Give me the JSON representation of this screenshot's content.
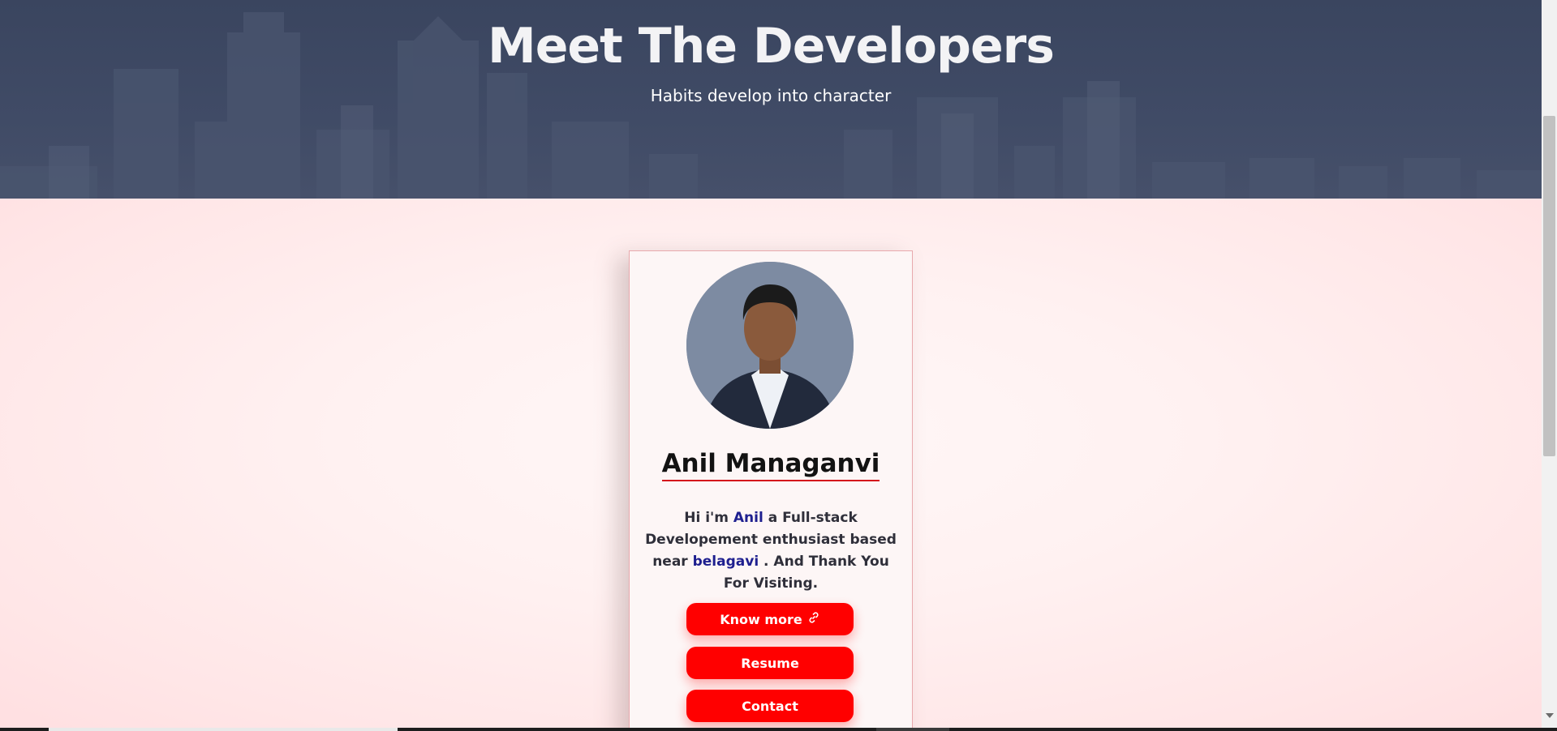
{
  "hero": {
    "title": "Meet The Developers",
    "subtitle": "Habits develop into character"
  },
  "card": {
    "name": "Anil Managanvi",
    "bio": {
      "part1": "Hi i'm ",
      "highlight_name": "Anil",
      "part2": " a Full-stack Developement enthusiast based near ",
      "highlight_place": "belagavi",
      "part3": " . And Thank You For Visiting."
    },
    "buttons": {
      "know_more": "Know more",
      "know_more_icon": "link-icon",
      "resume": "Resume",
      "contact": "Contact"
    }
  },
  "colors": {
    "hero_bg": "#3d4862",
    "accent_red": "#ff0000",
    "highlight_blue": "#1e1f8f",
    "underline_red": "#d4141b",
    "page_bg": "#fde7e8"
  }
}
